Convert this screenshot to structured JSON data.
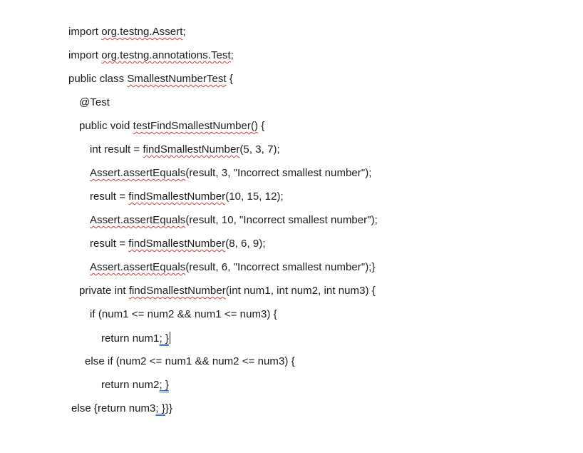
{
  "lines": [
    {
      "segments": [
        {
          "text": "import "
        },
        {
          "text": "org.testng.Assert",
          "mark": "spell"
        },
        {
          "text": ";"
        }
      ]
    },
    {
      "segments": [
        {
          "text": "import "
        },
        {
          "text": "org.testng.annotations.Test",
          "mark": "spell"
        },
        {
          "text": ";"
        }
      ]
    },
    {
      "segments": [
        {
          "text": "public class "
        },
        {
          "text": "SmallestNumberTest",
          "mark": "spell"
        },
        {
          "text": " {"
        }
      ]
    },
    {
      "segments": [
        {
          "text": "@Test"
        }
      ]
    },
    {
      "segments": [
        {
          "text": "public void "
        },
        {
          "text": "testFindSmallestNumber()",
          "mark": "spell"
        },
        {
          "text": " {"
        }
      ]
    },
    {
      "segments": [
        {
          "text": "int result = "
        },
        {
          "text": "findSmallestNumber",
          "mark": "spell"
        },
        {
          "text": "(5, 3, 7);"
        }
      ]
    },
    {
      "segments": [
        {
          "text": "Assert.assertEquals",
          "mark": "spell"
        },
        {
          "text": "(result, 3, \"Incorrect smallest number\");"
        }
      ]
    },
    {
      "segments": [
        {
          "text": "result = "
        },
        {
          "text": "findSmallestNumber",
          "mark": "spell"
        },
        {
          "text": "(10, 15, 12);"
        }
      ]
    },
    {
      "segments": [
        {
          "text": "Assert.assertEquals",
          "mark": "spell"
        },
        {
          "text": "(result, 10, \"Incorrect smallest number\");"
        }
      ]
    },
    {
      "segments": [
        {
          "text": "result = "
        },
        {
          "text": "findSmallestNumber",
          "mark": "spell"
        },
        {
          "text": "(8, 6, 9);"
        }
      ]
    },
    {
      "segments": [
        {
          "text": "Assert.assertEquals",
          "mark": "spell"
        },
        {
          "text": "(result, 6, \"Incorrect smallest number\");}"
        }
      ]
    },
    {
      "segments": [
        {
          "text": "private int "
        },
        {
          "text": "findSmallestNumber",
          "mark": "spell"
        },
        {
          "text": "(int num1, int num2, int num3) {"
        }
      ]
    },
    {
      "segments": [
        {
          "text": "if (num1 <= num2 && num1 <= num3) {"
        }
      ]
    },
    {
      "segments": [
        {
          "text": "return num1"
        },
        {
          "text": "; }",
          "mark": "grammar"
        }
      ],
      "cursor": true
    },
    {
      "segments": [
        {
          "text": "else if (num2 <= num1 && num2 <= num3) {"
        }
      ]
    },
    {
      "segments": [
        {
          "text": "return num2"
        },
        {
          "text": "; }",
          "mark": "grammar"
        }
      ]
    },
    {
      "segments": [
        {
          "text": "else {return num3"
        },
        {
          "text": "; }",
          "mark": "grammar"
        },
        {
          "text": "}}"
        }
      ]
    }
  ],
  "colors": {
    "text": "#1a1a1a",
    "spelling_underline": "#d23b3b",
    "grammar_underline": "#2b5fd0",
    "background": "#ffffff"
  }
}
